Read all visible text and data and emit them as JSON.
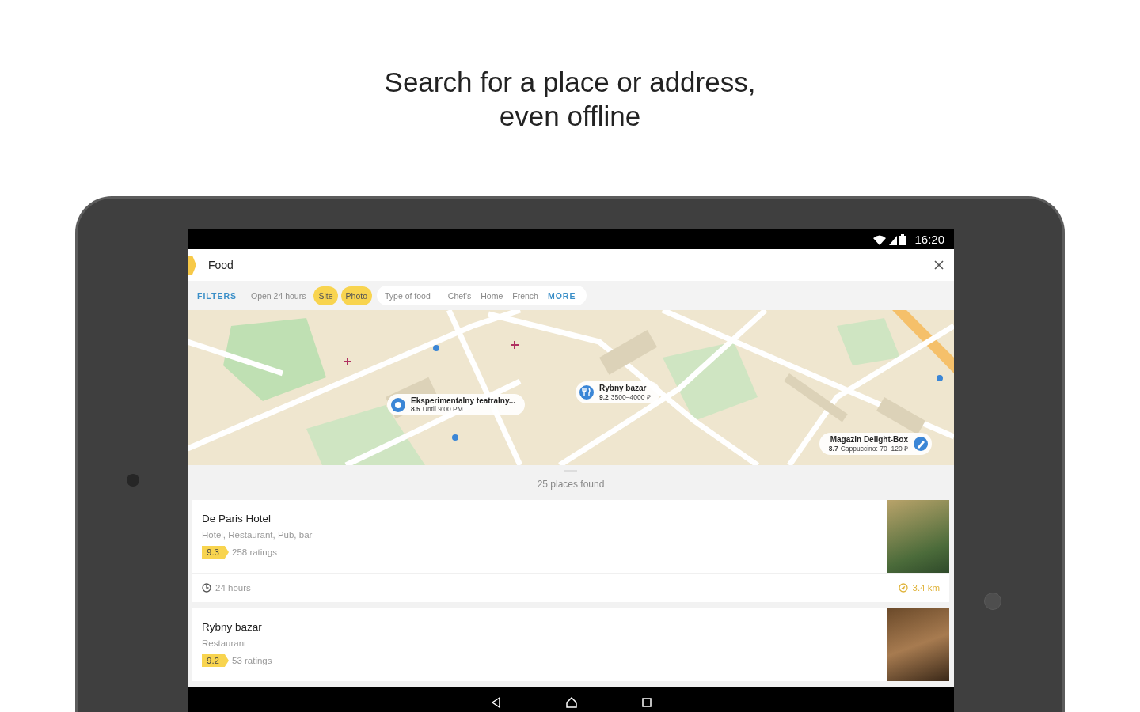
{
  "headline": {
    "lines": [
      "Search for a place or address,",
      "even offline"
    ]
  },
  "status_bar": {
    "time": "16:20"
  },
  "search": {
    "value": "Food"
  },
  "filters": {
    "title": "FILTERS",
    "chips": [
      {
        "label": "Open 24 hours",
        "selected": false
      },
      {
        "label": "Site",
        "selected": true
      },
      {
        "label": "Photo",
        "selected": true
      }
    ],
    "cuisine": {
      "label": "Type of food",
      "options": [
        {
          "label": "Chef's",
          "selected": false
        },
        {
          "label": "Home",
          "selected": false
        },
        {
          "label": "French",
          "selected": false
        }
      ]
    },
    "more": "MORE"
  },
  "map": {
    "callouts": [
      {
        "kind": "place",
        "name": "Eksperimentalny teatralny...",
        "rating": "8.5",
        "detail": "Until 9:00 PM"
      },
      {
        "kind": "restaurant",
        "name": "Rybny bazar",
        "rating": "9.2",
        "detail": "3500–4000 ₽"
      },
      {
        "kind": "cafe",
        "name": "Magazin Delight-Box",
        "rating": "8.7",
        "detail": "Cappuccino: 70–120 ₽"
      }
    ]
  },
  "results": {
    "count": "25 places found",
    "places": [
      {
        "name": "De Paris Hotel",
        "category": "Hotel, Restaurant, Pub, bar",
        "rating": "9.3",
        "ratings": "258 ratings",
        "hours": "24 hours",
        "distance": "3.4 km"
      },
      {
        "name": "Rybny bazar",
        "category": "Restaurant",
        "rating": "9.2",
        "ratings": "53 ratings"
      }
    ]
  }
}
